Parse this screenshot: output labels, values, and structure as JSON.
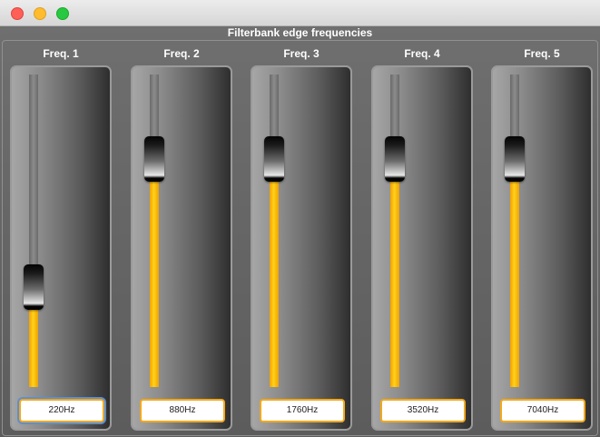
{
  "window": {
    "title": "Filterbank edge frequencies"
  },
  "colors": {
    "fill": "#ffc107",
    "field_border": "#f4a81a",
    "focus_ring": "#5d8fd0"
  },
  "channels": [
    {
      "label": "Freq. 1",
      "value": "220Hz",
      "level": 0.26,
      "focused": true
    },
    {
      "label": "Freq. 2",
      "value": "880Hz",
      "level": 0.67,
      "focused": false
    },
    {
      "label": "Freq. 3",
      "value": "1760Hz",
      "level": 0.67,
      "focused": false
    },
    {
      "label": "Freq. 4",
      "value": "3520Hz",
      "level": 0.67,
      "focused": false
    },
    {
      "label": "Freq. 5",
      "value": "7040Hz",
      "level": 0.67,
      "focused": false
    }
  ]
}
